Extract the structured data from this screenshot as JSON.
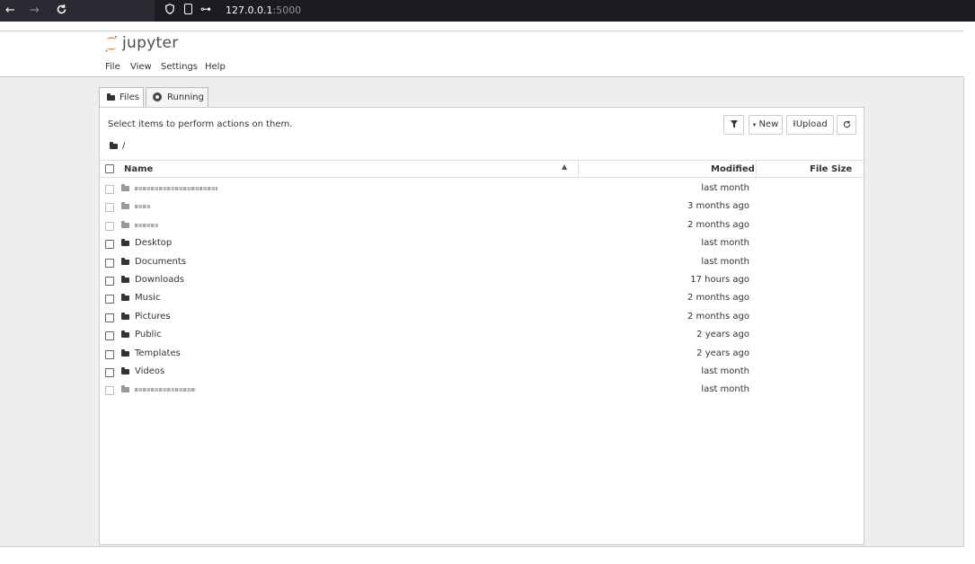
{
  "browser": {
    "url_host": "127.0.0.1",
    "url_port": ":5000"
  },
  "app": {
    "logo_text": "jupyter",
    "menu": [
      "File",
      "View",
      "Settings",
      "Help"
    ]
  },
  "tabs": {
    "files": "Files",
    "running": "Running"
  },
  "panel": {
    "notice": "Select items to perform actions on them.",
    "breadcrumb": "/",
    "buttons": {
      "new": "New",
      "upload": "Upload"
    }
  },
  "table": {
    "headers": {
      "name": "Name",
      "modified": "Modified",
      "size": "File Size"
    },
    "rows": [
      {
        "name": "",
        "modified": "last month"
      },
      {
        "name": "",
        "modified": "3 months ago"
      },
      {
        "name": "",
        "modified": "2 months ago"
      },
      {
        "name": "Desktop",
        "modified": "last month"
      },
      {
        "name": "Documents",
        "modified": "last month"
      },
      {
        "name": "Downloads",
        "modified": "17 hours ago"
      },
      {
        "name": "Music",
        "modified": "2 months ago"
      },
      {
        "name": "Pictures",
        "modified": "2 months ago"
      },
      {
        "name": "Public",
        "modified": "2 years ago"
      },
      {
        "name": "Templates",
        "modified": "2 years ago"
      },
      {
        "name": "Videos",
        "modified": "last month"
      },
      {
        "name": "",
        "modified": "last month"
      }
    ]
  },
  "colors": {
    "chrome_bg": "#2b2a33",
    "urlbar_bg": "#1c1b22",
    "logo_orange": "#f37726",
    "page_bg": "#eeeeee"
  },
  "icons": [
    "back-arrow-icon",
    "forward-arrow-icon",
    "reload-icon",
    "shield-icon",
    "document-icon",
    "key-icon",
    "folder-icon",
    "running-icon",
    "filter-icon",
    "caret-down-icon",
    "upload-icon",
    "refresh-icon",
    "sort-up-icon"
  ]
}
